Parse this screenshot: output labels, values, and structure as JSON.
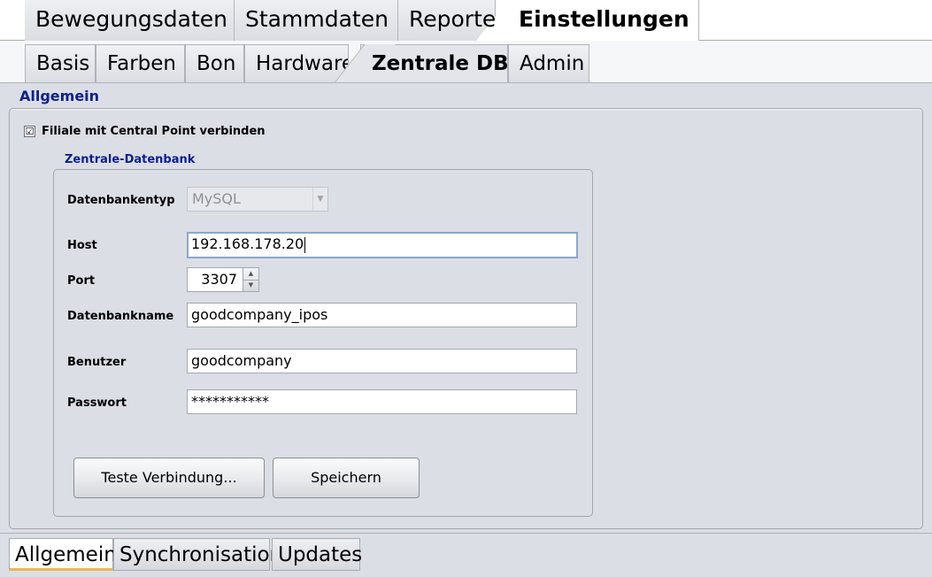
{
  "main_tabs": [
    {
      "label": "Bewegungsdaten"
    },
    {
      "label": "Stammdaten"
    },
    {
      "label": "Reporte"
    },
    {
      "label": "Einstellungen"
    }
  ],
  "main_active": "Einstellungen",
  "sub_tabs": [
    {
      "label": "Basis"
    },
    {
      "label": "Farben"
    },
    {
      "label": "Bon"
    },
    {
      "label": "Hardware"
    },
    {
      "label": "Zentrale DB"
    },
    {
      "label": "Admin"
    }
  ],
  "sub_active": "Zentrale DB",
  "section_title": "Allgemein",
  "connect_checkbox": {
    "label": "Filiale mit Central Point verbinden",
    "checked": true,
    "mark": "☑"
  },
  "db_group": {
    "title": "Zentrale-Datenbank",
    "type_label": "Datenbankentyp",
    "type_value": "MySQL",
    "host_label": "Host",
    "host_value": "192.168.178.20",
    "port_label": "Port",
    "port_value": "3307",
    "dbname_label": "Datenbankname",
    "dbname_value": "goodcompany_ipos",
    "user_label": "Benutzer",
    "user_value": "goodcompany",
    "password_label": "Passwort",
    "password_value": "***********"
  },
  "buttons": {
    "test": "Teste Verbindung...",
    "save": "Speichern"
  },
  "bottom_tabs": [
    {
      "label": "Allgemein"
    },
    {
      "label": "Synchronisation"
    },
    {
      "label": "Updates"
    }
  ],
  "bottom_active": "Allgemein",
  "colors": {
    "accent_title": "#0b1f8f",
    "active_underline": "#e9b65b",
    "focus_border": "#8ba7c9"
  },
  "icons": {
    "checkbox": "checkbox-checked-icon",
    "dropdown": "chevron-down-icon",
    "spin_up": "triangle-up-icon",
    "spin_down": "triangle-down-icon"
  }
}
